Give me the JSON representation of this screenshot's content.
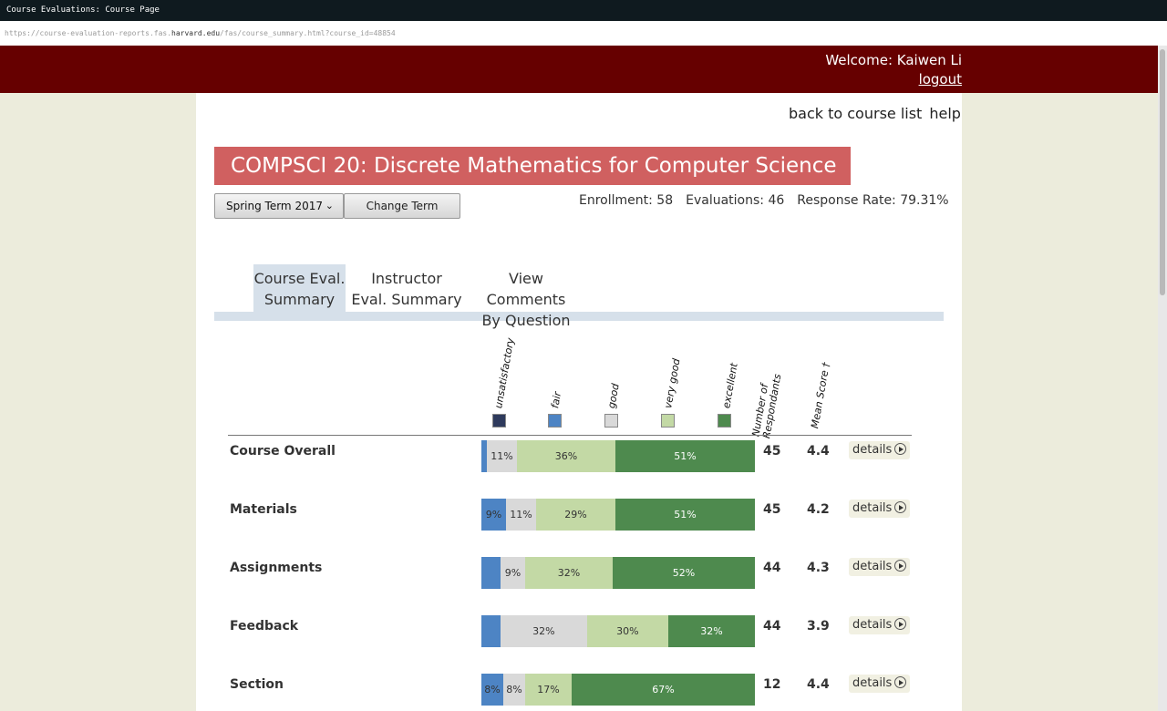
{
  "window": {
    "title": "Course Evaluations: Course Page"
  },
  "url": {
    "prefix": "https://course-evaluation-reports.fas.",
    "host": "harvard.edu",
    "suffix": "/fas/course_summary.html?course_id=48854"
  },
  "header": {
    "welcome": "Welcome: Kaiwen Li",
    "logout": "logout"
  },
  "nav": {
    "back": "back to course list",
    "help": "help"
  },
  "course": {
    "title": "COMPSCI 20: Discrete Mathematics for Computer Science"
  },
  "term": {
    "selected": "Spring Term 2017",
    "change_button": "Change Term"
  },
  "stats": {
    "enrollment": "Enrollment: 58",
    "evaluations": "Evaluations: 46",
    "response_rate": "Response Rate: 79.31%"
  },
  "tabs": [
    {
      "line1": "Course Eval.",
      "line2": "Summary"
    },
    {
      "line1": "Instructor",
      "line2": "Eval. Summary"
    },
    {
      "line1": "View Comments",
      "line2": "By Question"
    }
  ],
  "legend": {
    "labels": [
      "unsatisfactory",
      "fair",
      "good",
      "very good",
      "excellent"
    ],
    "respondents_line1": "Number of",
    "respondents_line2": "Respondants",
    "mean": "Mean Score †"
  },
  "colors": {
    "unsatisfactory": "#2e3a5c",
    "fair": "#4d84c4",
    "good": "#d9d9d9",
    "very_good": "#c3d9a5",
    "excellent": "#4e8a4e"
  },
  "details_label": "details",
  "rows": [
    {
      "label": "Course Overall",
      "unsat": 0,
      "fair": 2,
      "good": 11,
      "very_good": 36,
      "excellent": 51,
      "good_text": "11%",
      "very_good_text": "36%",
      "excellent_text": "51%",
      "fair_text": "",
      "respondents": "45",
      "mean": "4.4"
    },
    {
      "label": "Materials",
      "unsat": 0,
      "fair": 9,
      "good": 11,
      "very_good": 29,
      "excellent": 51,
      "fair_text": "9%",
      "good_text": "11%",
      "very_good_text": "29%",
      "excellent_text": "51%",
      "respondents": "45",
      "mean": "4.2"
    },
    {
      "label": "Assignments",
      "unsat": 0,
      "fair": 7,
      "good": 9,
      "very_good": 32,
      "excellent": 52,
      "fair_text": "",
      "good_text": "9%",
      "very_good_text": "32%",
      "excellent_text": "52%",
      "respondents": "44",
      "mean": "4.3"
    },
    {
      "label": "Feedback",
      "unsat": 0,
      "fair": 7,
      "good": 32,
      "very_good": 30,
      "excellent": 32,
      "fair_text": "",
      "good_text": "32%",
      "very_good_text": "30%",
      "excellent_text": "32%",
      "respondents": "44",
      "mean": "3.9"
    },
    {
      "label": "Section",
      "unsat": 0,
      "fair": 8,
      "good": 8,
      "very_good": 17,
      "excellent": 67,
      "fair_text": "8%",
      "good_text": "8%",
      "very_good_text": "17%",
      "excellent_text": "67%",
      "respondents": "12",
      "mean": "4.4"
    }
  ]
}
